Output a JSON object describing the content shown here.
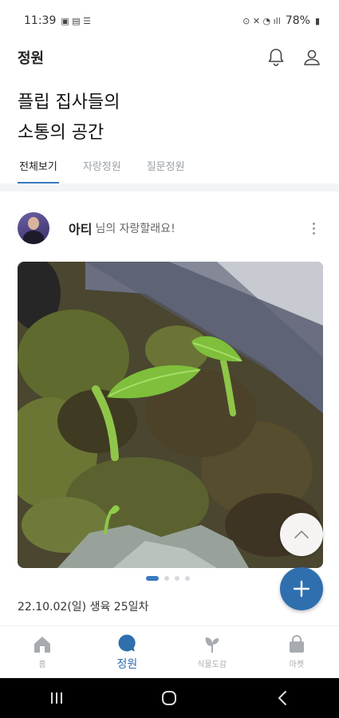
{
  "status_bar": {
    "time": "11:39",
    "battery": "78%"
  },
  "header": {
    "title": "정원"
  },
  "headline": {
    "line1": "플립 집사들의",
    "line2": "소통의 공간"
  },
  "tabs": [
    {
      "label": "전체보기",
      "active": true
    },
    {
      "label": "자랑정원",
      "active": false
    },
    {
      "label": "질문정원",
      "active": false
    }
  ],
  "post": {
    "author": "아티",
    "suffix": "님의 자랑할래요!",
    "date": "22.10.02(일) 생육 25일차",
    "image_count": 4,
    "current_image": 1
  },
  "nav": [
    {
      "label": "홈",
      "icon": "home-icon",
      "active": false
    },
    {
      "label": "정원",
      "icon": "chat-bubble-icon",
      "active": true
    },
    {
      "label": "식물도감",
      "icon": "leaf-icon",
      "active": false
    },
    {
      "label": "마켓",
      "icon": "shopping-bag-icon",
      "active": false
    }
  ],
  "colors": {
    "accent": "#2f6fae",
    "tab_underline": "#3b7bbf",
    "inactive": "#a7abb0"
  }
}
